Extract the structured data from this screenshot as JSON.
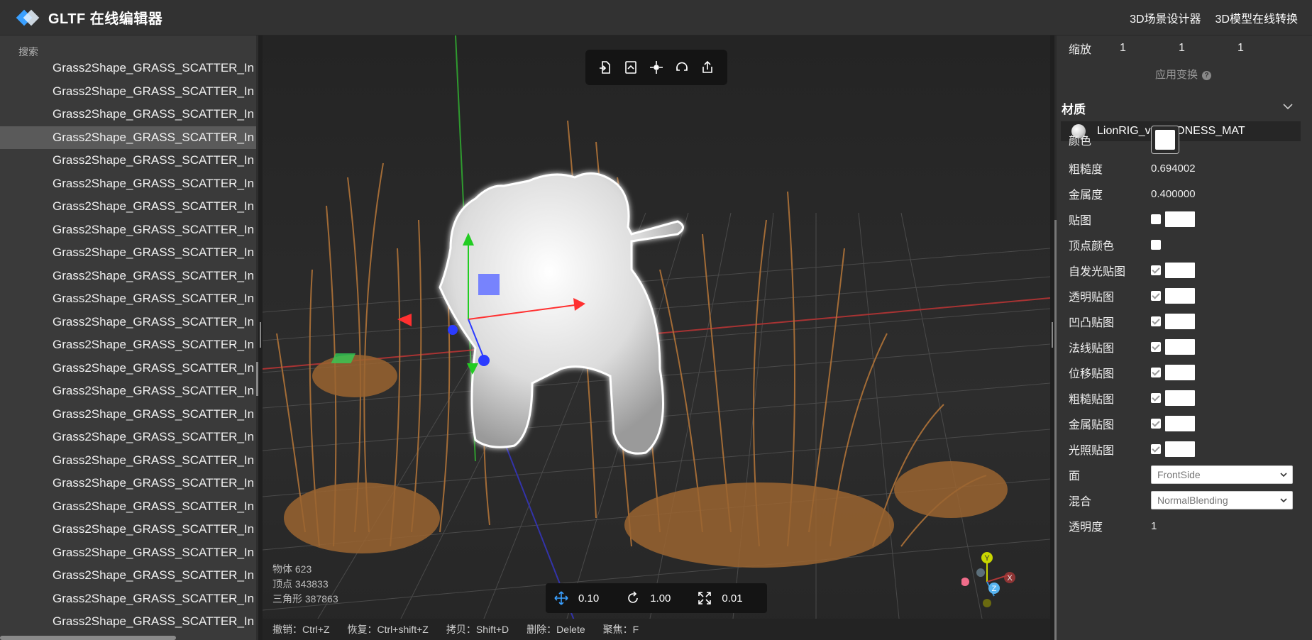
{
  "app": {
    "title": "GLTF 在线编辑器"
  },
  "header_links": [
    "3D场景设计器",
    "3D模型在线转换"
  ],
  "left_panel": {
    "search_label": "搜索",
    "tree_items": [
      "Grass2Shape_GRASS_SCATTER_In",
      "Grass2Shape_GRASS_SCATTER_In",
      "Grass2Shape_GRASS_SCATTER_In",
      "Grass2Shape_GRASS_SCATTER_In",
      "Grass2Shape_GRASS_SCATTER_In",
      "Grass2Shape_GRASS_SCATTER_In",
      "Grass2Shape_GRASS_SCATTER_In",
      "Grass2Shape_GRASS_SCATTER_In",
      "Grass2Shape_GRASS_SCATTER_In",
      "Grass2Shape_GRASS_SCATTER_In",
      "Grass2Shape_GRASS_SCATTER_In",
      "Grass2Shape_GRASS_SCATTER_In",
      "Grass2Shape_GRASS_SCATTER_In",
      "Grass2Shape_GRASS_SCATTER_In",
      "Grass2Shape_GRASS_SCATTER_In",
      "Grass2Shape_GRASS_SCATTER_In",
      "Grass2Shape_GRASS_SCATTER_In",
      "Grass2Shape_GRASS_SCATTER_In",
      "Grass2Shape_GRASS_SCATTER_In",
      "Grass2Shape_GRASS_SCATTER_In",
      "Grass2Shape_GRASS_SCATTER_In",
      "Grass2Shape_GRASS_SCATTER_In",
      "Grass2Shape_GRASS_SCATTER_In",
      "Grass2Shape_GRASS_SCATTER_In",
      "Grass2Shape_GRASS_SCATTER_In",
      "Grass2Shape_GRASS_SCATTER_In"
    ],
    "selected_index": 3
  },
  "viewport": {
    "toolbar_icons": [
      "import-icon",
      "export-file-icon",
      "focus-icon",
      "reset-view-icon",
      "share-icon"
    ],
    "stats": {
      "objects": "物体 623",
      "vertices": "顶点 343833",
      "triangles": "三角形 387863"
    },
    "snap": {
      "translate": "0.10",
      "rotate": "1.00",
      "scale": "0.01"
    },
    "shortcuts": [
      "撤销：Ctrl+Z",
      "恢复：Ctrl+shift+Z",
      "拷贝：Shift+D",
      "删除：Delete",
      "聚焦：F"
    ],
    "gizmo_labels": {
      "y": "Y",
      "x": "X",
      "z": "Z"
    }
  },
  "right_panel": {
    "scale": {
      "label": "缩放",
      "x": "1",
      "y": "1",
      "z": "1"
    },
    "apply_transform": "应用变换",
    "material_section": "材质",
    "material_name": "LionRIG_v02:LIONESS_MAT",
    "props": {
      "color": "颜色",
      "roughness": {
        "label": "粗糙度",
        "value": "0.694002"
      },
      "metalness": {
        "label": "金属度",
        "value": "0.400000"
      },
      "map": "贴图",
      "vertex_colors": "顶点颜色",
      "emissive_map": "自发光贴图",
      "alpha_map": "透明贴图",
      "bump_map": "凹凸贴图",
      "normal_map": "法线贴图",
      "displacement_map": "位移贴图",
      "roughness_map": "粗糙贴图",
      "metalness_map": "金属贴图",
      "light_map": "光照贴图",
      "side": {
        "label": "面",
        "value": "FrontSide"
      },
      "blending": {
        "label": "混合",
        "value": "NormalBlending"
      },
      "opacity": {
        "label": "透明度",
        "value": "1"
      }
    }
  },
  "colors": {
    "accent": "#3aa0ff",
    "header_bg": "#323232",
    "panel_bg": "#3a3a3a",
    "viewport_bg": "#2a2a2a"
  }
}
